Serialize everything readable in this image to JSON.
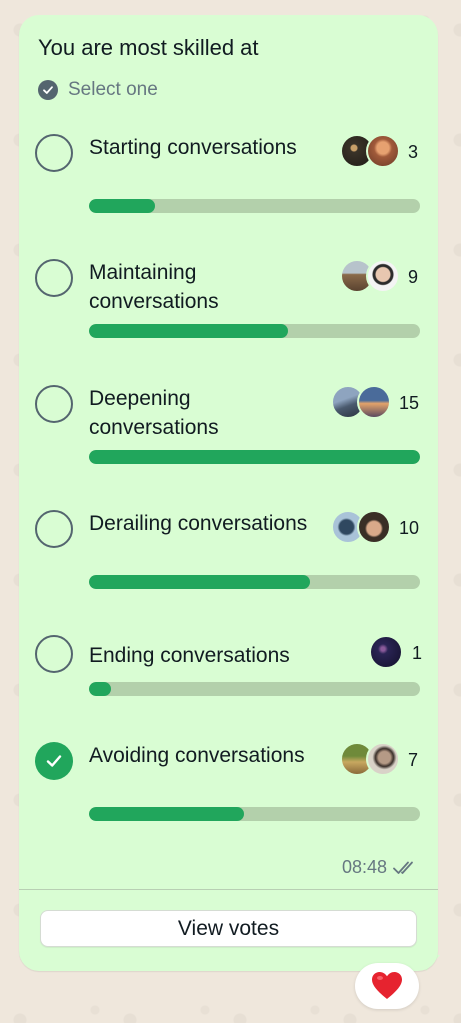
{
  "poll": {
    "question": "You are most skilled at",
    "select_hint": "Select one",
    "time": "08:48",
    "view_votes_label": "View votes",
    "reaction": "heart",
    "colors": {
      "bubble": "#d9fdd3",
      "accent": "#21a65c",
      "track": "#b3d0ab",
      "wallpaper": "#efe7dc"
    },
    "options": [
      {
        "label": "Starting conversations",
        "votes": "3",
        "fraction": 0.2,
        "selected": false
      },
      {
        "label": "Maintaining conversations",
        "votes": "9",
        "fraction": 0.6,
        "selected": false
      },
      {
        "label": "Deepening conversations",
        "votes": "15",
        "fraction": 1.0,
        "selected": false
      },
      {
        "label": "Derailing conversations",
        "votes": "10",
        "fraction": 0.667,
        "selected": false
      },
      {
        "label": "Ending conversations",
        "votes": "1",
        "fraction": 0.067,
        "selected": false
      },
      {
        "label": "Avoiding conversations",
        "votes": "7",
        "fraction": 0.467,
        "selected": true
      }
    ]
  }
}
